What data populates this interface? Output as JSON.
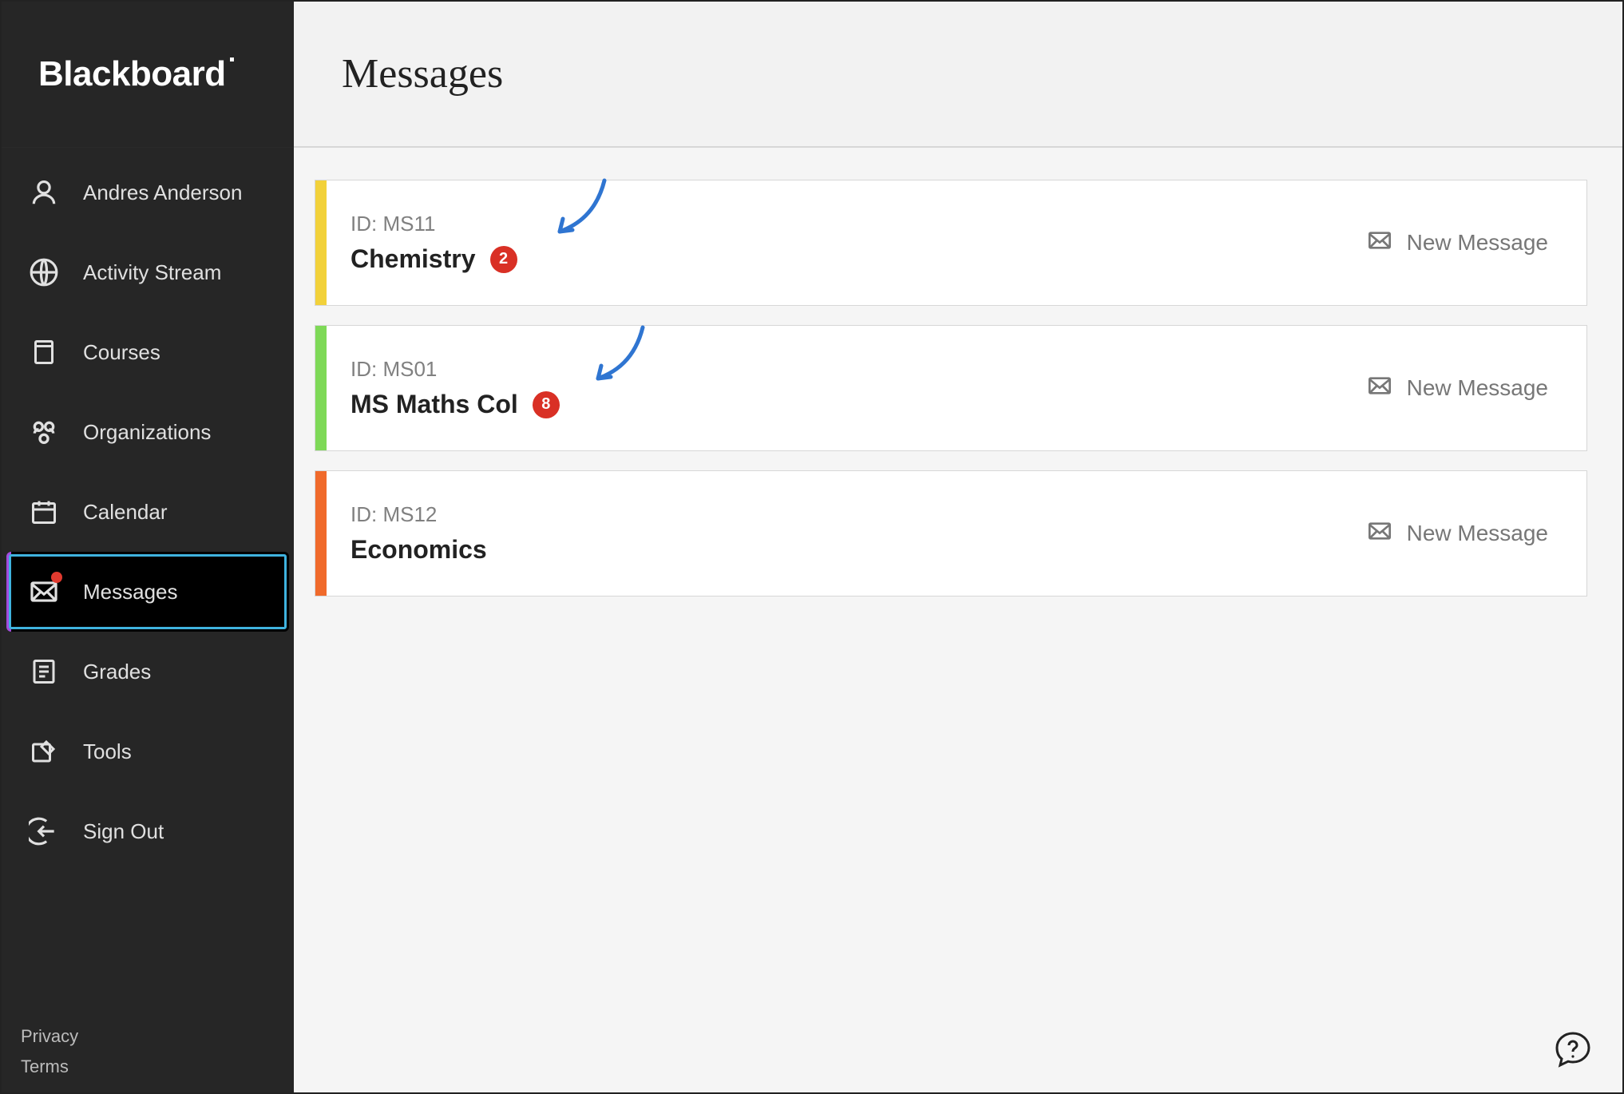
{
  "brand": "Blackboard",
  "user_name": "Andres Anderson",
  "nav": {
    "activity_stream": "Activity Stream",
    "courses": "Courses",
    "organizations": "Organizations",
    "calendar": "Calendar",
    "messages": "Messages",
    "grades": "Grades",
    "tools": "Tools",
    "sign_out": "Sign Out"
  },
  "footer": {
    "privacy": "Privacy",
    "terms": "Terms"
  },
  "page": {
    "title": "Messages",
    "new_message_label": "New Message"
  },
  "courses": [
    {
      "id_label": "ID: MS11",
      "name": "Chemistry",
      "badge": "2",
      "stripe": "#f2d13a",
      "has_badge": true
    },
    {
      "id_label": "ID: MS01",
      "name": "MS Maths Col",
      "badge": "8",
      "stripe": "#7ed957",
      "has_badge": true
    },
    {
      "id_label": "ID: MS12",
      "name": "Economics",
      "badge": "",
      "stripe": "#f06a2b",
      "has_badge": false
    }
  ]
}
